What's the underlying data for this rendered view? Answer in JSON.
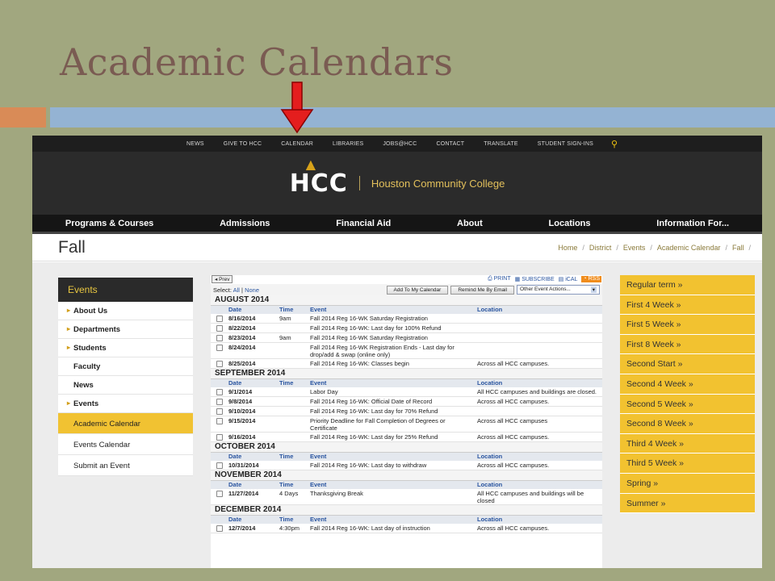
{
  "slide": {
    "title": "Academic Calendars"
  },
  "top_nav": [
    "NEWS",
    "GIVE TO HCC",
    "CALENDAR",
    "LIBRARIES",
    "JOBS@HCC",
    "CONTACT",
    "TRANSLATE",
    "STUDENT SIGN-INS"
  ],
  "brand": {
    "logo": "HCC",
    "college": "Houston Community College"
  },
  "main_nav": [
    "Programs & Courses",
    "Admissions",
    "Financial Aid",
    "About",
    "Locations",
    "Information For..."
  ],
  "page": {
    "heading": "Fall"
  },
  "breadcrumb": [
    "Home",
    "District",
    "Events",
    "Academic Calendar",
    "Fall"
  ],
  "sidebar": {
    "header": "Events",
    "items": [
      {
        "label": "About Us",
        "arrow": true
      },
      {
        "label": "Departments",
        "arrow": true
      },
      {
        "label": "Students",
        "arrow": true
      },
      {
        "label": "Faculty",
        "arrow": false
      },
      {
        "label": "News",
        "arrow": false
      },
      {
        "label": "Events",
        "arrow": true
      },
      {
        "label": "Academic Calendar",
        "active": true
      },
      {
        "label": "Events Calendar"
      },
      {
        "label": "Submit an Event"
      }
    ]
  },
  "calendar": {
    "prev_label": "Prev",
    "tools": {
      "print": "PRINT",
      "subscribe": "SUBSCRIBE",
      "ical": "iCAL",
      "rss": "RSS"
    },
    "select_label": "Select:",
    "select_all": "All",
    "select_none": "None",
    "add_button": "Add To My Calendar",
    "remind_button": "Remind Me By Email",
    "other_actions": "Other Event Actions...",
    "columns": {
      "date": "Date",
      "time": "Time",
      "event": "Event",
      "location": "Location"
    },
    "months": [
      {
        "name": "AUGUST 2014",
        "rows": [
          {
            "date": "8/16/2014",
            "time": "9am",
            "event": "Fall 2014 Reg 16-WK Saturday Registration",
            "location": ""
          },
          {
            "date": "8/22/2014",
            "time": "",
            "event": "Fall 2014 Reg 16-WK: Last day for 100% Refund",
            "location": ""
          },
          {
            "date": "8/23/2014",
            "time": "9am",
            "event": "Fall 2014 Reg 16-WK Saturday Registration",
            "location": ""
          },
          {
            "date": "8/24/2014",
            "time": "",
            "event": "Fall 2014 Reg 16-WK Registration Ends - Last day for drop/add & swap (online only)",
            "location": ""
          },
          {
            "date": "8/25/2014",
            "time": "",
            "event": "Fall 2014 Reg 16-WK: Classes begin",
            "location": "Across all HCC campuses."
          }
        ]
      },
      {
        "name": "SEPTEMBER 2014",
        "rows": [
          {
            "date": "9/1/2014",
            "time": "",
            "event": "Labor Day",
            "location": "All HCC campuses and buildings are closed."
          },
          {
            "date": "9/8/2014",
            "time": "",
            "event": "Fall 2014 Reg 16-WK: Official Date of Record",
            "location": "Across all HCC campuses."
          },
          {
            "date": "9/10/2014",
            "time": "",
            "event": "Fall 2014 Reg 16-WK: Last day for 70% Refund",
            "location": ""
          },
          {
            "date": "9/15/2014",
            "time": "",
            "event": "Priority Deadline for Fall Completion of Degrees or Certificate",
            "location": "Across all HCC campuses"
          },
          {
            "date": "9/16/2014",
            "time": "",
            "event": "Fall 2014 Reg 16-WK: Last day for 25% Refund",
            "location": "Across all HCC campuses."
          }
        ]
      },
      {
        "name": "OCTOBER 2014",
        "rows": [
          {
            "date": "10/31/2014",
            "time": "",
            "event": "Fall 2014 Reg 16-WK: Last day to withdraw",
            "location": "Across all HCC campuses."
          }
        ]
      },
      {
        "name": "NOVEMBER 2014",
        "rows": [
          {
            "date": "11/27/2014",
            "time": "4 Days",
            "event": "Thanksgiving Break",
            "location": "All HCC campuses and buildings will be closed"
          }
        ]
      },
      {
        "name": "DECEMBER 2014",
        "rows": [
          {
            "date": "12/7/2014",
            "time": "4:30pm",
            "event": "Fall 2014 Reg 16-WK: Last day of instruction",
            "location": "Across all HCC campuses."
          }
        ]
      }
    ]
  },
  "right_links": [
    "Regular term »",
    "First 4 Week »",
    "First 5 Week »",
    "First 8 Week »",
    "Second Start »",
    "Second 4 Week »",
    "Second 5 Week »",
    "Second 8 Week »",
    "Third 4 Week »",
    "Third 5 Week »",
    "Spring »",
    "Summer »"
  ]
}
